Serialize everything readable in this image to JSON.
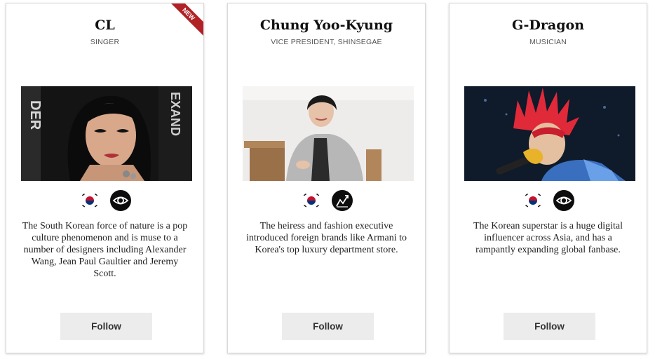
{
  "cards": [
    {
      "name": "CL",
      "role": "SINGER",
      "badge_new": "NEW",
      "badges": [
        "korea-flag-icon",
        "eye-icon"
      ],
      "description": "The South Korean force of nature is a pop culture phenomenon and is muse to a number of designers including Alexander Wang, Jean Paul Gaultier and Jeremy Scott.",
      "follow_label": "Follow",
      "backdrop_text_left": "DER",
      "backdrop_text_right": "EXAND"
    },
    {
      "name": "Chung Yoo-Kyung",
      "role": "VICE PRESIDENT, SHINSEGAE",
      "badges": [
        "korea-flag-icon",
        "growth-chart-icon"
      ],
      "description": "The heiress and fashion executive introduced foreign brands like Armani to Korea's top luxury department store.",
      "follow_label": "Follow"
    },
    {
      "name": "G-Dragon",
      "role": "MUSICIAN",
      "badges": [
        "korea-flag-icon",
        "eye-icon"
      ],
      "description": "The Korean superstar is a huge digital influencer across Asia, and has a rampantly expanding global fanbase.",
      "follow_label": "Follow"
    }
  ],
  "colors": {
    "ribbon": "#b02226",
    "button_bg": "#ececec",
    "card_border": "#d9d9d9"
  }
}
